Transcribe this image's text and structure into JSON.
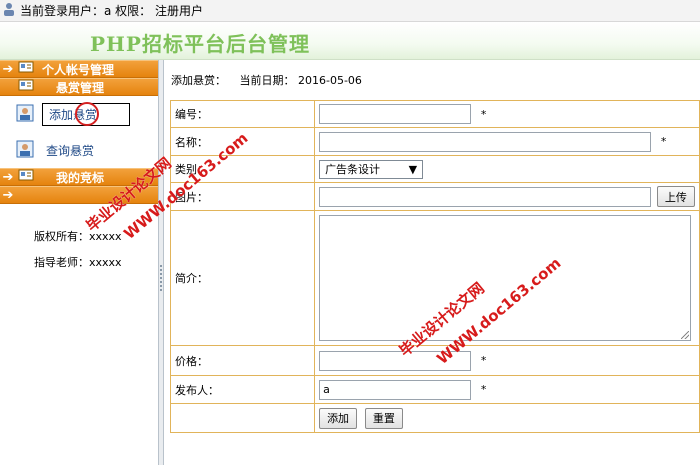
{
  "topbar": {
    "text": "当前登录用户：a 权限： 注册用户"
  },
  "header": {
    "title": "PHP招标平台后台管理"
  },
  "sidebar": {
    "sections": {
      "account": "个人帐号管理",
      "reward": "悬赏管理",
      "bid": "我的竞标"
    },
    "items": {
      "add": "添加悬赏",
      "query": "查询悬赏"
    },
    "copyright": "版权所有：xxxxx",
    "teacher": "指导老师：xxxxx"
  },
  "main": {
    "crumb": "添加悬赏：",
    "date": "当前日期： 2016-05-06",
    "form": {
      "number_label": "编号：",
      "name_label": "名称：",
      "category_label": "类别：",
      "category_value": "广告条设计",
      "image_label": "图片：",
      "upload_button": "上传",
      "intro_label": "简介：",
      "price_label": "价格：",
      "publisher_label": "发布人：",
      "publisher_value": "a",
      "required_mark": "*",
      "submit_button": "添加",
      "reset_button": "重置"
    }
  },
  "watermark": {
    "url": "WWW.doc163.com",
    "site": "毕业设计论文网"
  },
  "colors": {
    "accent": "#e5830e",
    "title_green": "#7fc15a",
    "border": "#e1b45a",
    "watermark": "#d71b1b"
  }
}
